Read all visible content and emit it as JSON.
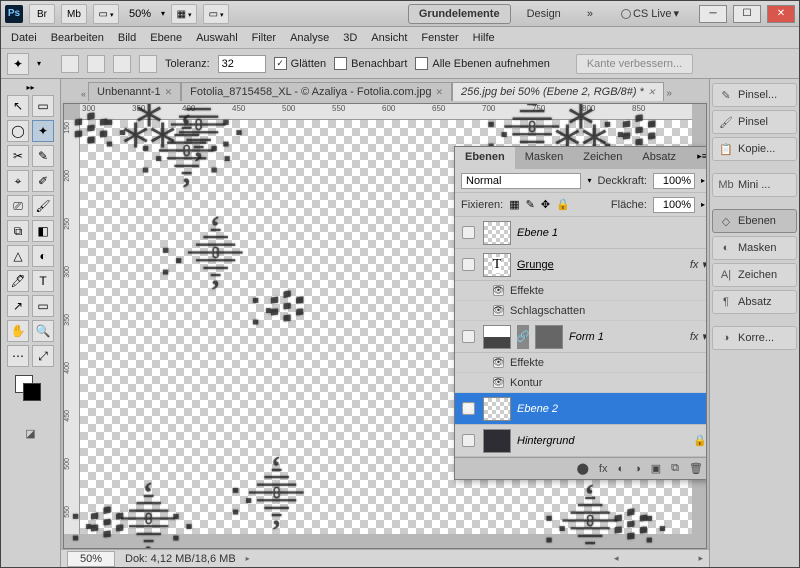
{
  "titlebar": {
    "br": "Br",
    "mb": "Mb",
    "zoom": "50%",
    "arrows": "▾",
    "workspace_active": "Grundelemente",
    "workspace_b": "Design",
    "more": "»",
    "cslive": "CS Live"
  },
  "menu": [
    "Datei",
    "Bearbeiten",
    "Bild",
    "Ebene",
    "Auswahl",
    "Filter",
    "Analyse",
    "3D",
    "Ansicht",
    "Fenster",
    "Hilfe"
  ],
  "opt": {
    "toleranz_label": "Toleranz:",
    "toleranz_value": "32",
    "glatten": "Glätten",
    "benachbart": "Benachbart",
    "alle": "Alle Ebenen aufnehmen",
    "kante": "Kante verbessern..."
  },
  "tabs": [
    {
      "label": "Unbenannt-1",
      "active": false
    },
    {
      "label": "Fotolia_8715458_XL - © Azaliya - Fotolia.com.jpg",
      "active": false
    },
    {
      "label": "256.jpg bei 50% (Ebene 2, RGB/8#) *",
      "active": true
    }
  ],
  "ruler_h": [
    "300",
    "350",
    "400",
    "450",
    "500",
    "550",
    "600",
    "650",
    "700",
    "750",
    "800",
    "850"
  ],
  "ruler_v": [
    "150",
    "200",
    "250",
    "300",
    "350",
    "400",
    "450",
    "500",
    "550"
  ],
  "status": {
    "zoom": "50%",
    "dok": "Dok: 4,12 MB/18,6 MB"
  },
  "panel": {
    "tabs": [
      "Ebenen",
      "Masken",
      "Zeichen",
      "Absatz"
    ],
    "blend": "Normal",
    "opacity_label": "Deckkraft:",
    "opacity": "100%",
    "lock_label": "Fixieren:",
    "fill_label": "Fläche:",
    "fill": "100%",
    "layers": [
      {
        "name": "Ebene 1",
        "type": "layer"
      },
      {
        "name": "Grunge",
        "type": "text",
        "fx": true
      },
      {
        "sub": "Effekte"
      },
      {
        "sub": "Schlagschatten"
      },
      {
        "name": "Form 1",
        "type": "shape",
        "fx": true
      },
      {
        "sub": "Effekte"
      },
      {
        "sub": "Kontur"
      },
      {
        "name": "Ebene 2",
        "type": "layer",
        "sel": true,
        "visible": true
      },
      {
        "name": "Hintergrund",
        "type": "bg",
        "lock": true
      }
    ],
    "foot_icons": [
      "⬤",
      "fx",
      "◐",
      "◑",
      "▣",
      "⧉",
      "🗑"
    ]
  },
  "dock": [
    {
      "label": "Pinsel...",
      "icon": "✎"
    },
    {
      "label": "Pinsel",
      "icon": "🖌"
    },
    {
      "label": "Kopie...",
      "icon": "📋"
    },
    {
      "label": "Mini ...",
      "icon": "Mb",
      "sep": true
    },
    {
      "label": "Ebenen",
      "icon": "◇",
      "active": true,
      "sep": true
    },
    {
      "label": "Masken",
      "icon": "◐"
    },
    {
      "label": "Zeichen",
      "icon": "A|"
    },
    {
      "label": "Absatz",
      "icon": "¶"
    },
    {
      "label": "Korre...",
      "icon": "◑",
      "sep": true
    }
  ],
  "tools": [
    "↖",
    "▭",
    "◯",
    "✦",
    "✂",
    "✎",
    "⌖",
    "✐",
    "⎚",
    "🖌",
    "⧉",
    "◧",
    "△",
    "◐",
    "🖊",
    "T",
    "↗",
    "▭",
    "✋",
    "🔍",
    "⋯",
    "⤢"
  ]
}
